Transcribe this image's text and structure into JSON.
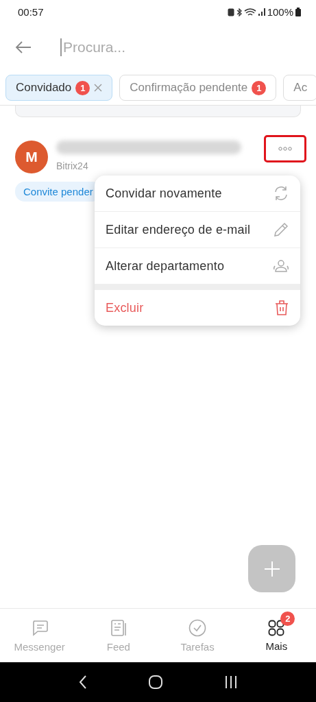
{
  "status_bar": {
    "time": "00:57",
    "battery": "100%"
  },
  "search": {
    "placeholder": "Procura..."
  },
  "filters": [
    {
      "label": "Convidado",
      "count": "1",
      "selected": true
    },
    {
      "label": "Confirmação pendente",
      "count": "1",
      "selected": false
    },
    {
      "label": "Ac",
      "selected": false
    }
  ],
  "user": {
    "initial": "M",
    "subtitle": "Bitrix24",
    "tag": "Convite pender",
    "more_button": {
      "highlighted": true
    }
  },
  "menu": [
    {
      "label": "Convidar novamente",
      "kind": "normal"
    },
    {
      "label": "Editar endereço de e-mail",
      "kind": "normal"
    },
    {
      "label": "Alterar departamento",
      "kind": "normal"
    },
    {
      "label": "Excluir",
      "kind": "danger"
    }
  ],
  "bottom_nav": [
    {
      "label": "Messenger",
      "selected": false
    },
    {
      "label": "Feed",
      "selected": false
    },
    {
      "label": "Tarefas",
      "selected": false
    },
    {
      "label": "Mais",
      "selected": true,
      "badge": "2"
    }
  ]
}
